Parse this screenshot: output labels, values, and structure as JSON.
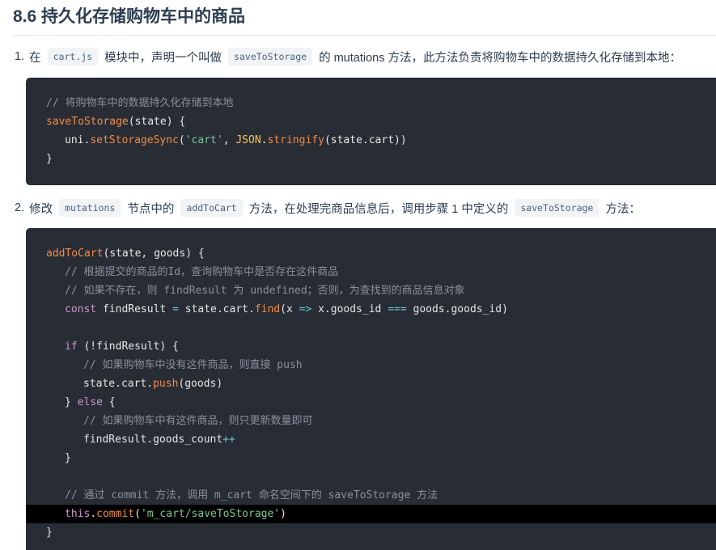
{
  "section": {
    "title": "8.6 持久化存储购物车中的商品"
  },
  "step1": {
    "num": "1.",
    "pre": "在",
    "code1": "cart.js",
    "mid": "模块中，声明一个叫做",
    "code2": "saveToStorage",
    "post": "的 mutations 方法，此方法负责将购物车中的数据持久化存储到本地："
  },
  "block1": {
    "comment": "// 将购物车中的数据持久化存储到本地",
    "fn_name": "saveToStorage",
    "fn_args": "(state) {",
    "call_obj": "uni.",
    "call_fn": "setStorageSync",
    "call_open": "(",
    "call_str": "'cart'",
    "call_comma": ", ",
    "json": "JSON",
    "dot": ".",
    "stringify": "stringify",
    "call_rest": "(state.cart))",
    "close": "}"
  },
  "step2": {
    "num": "2.",
    "pre": "修改",
    "code1": "mutations",
    "mid1": "节点中的",
    "code2": "addToCart",
    "mid2": "方法，在处理完商品信息后，调用步骤 1 中定义的",
    "code3": "saveToStorage",
    "post": "方法："
  },
  "block2": {
    "l1_fn": "addToCart",
    "l1_rest": "(state, goods) {",
    "l2": "// 根据提交的商品的Id，查询购物车中是否存在这件商品",
    "l3": "// 如果不存在，则 findResult 为 undefined；否则，为查找到的商品信息对象",
    "l4_kw": "const",
    "l4_a": " findResult ",
    "l4_eq": "=",
    "l4_b": " state.cart.",
    "l4_find": "find",
    "l4_c": "(x ",
    "l4_arrow": "=>",
    "l4_d": " x.goods_id ",
    "l4_eqq": "===",
    "l4_e": " goods.goods_id)",
    "l6_kw": "if",
    "l6_rest": " (!findResult) {",
    "l7": "// 如果购物车中没有这件商品，则直接 push",
    "l8_a": "state.cart.",
    "l8_push": "push",
    "l8_b": "(goods)",
    "l9_a": "} ",
    "l9_kw": "else",
    "l9_b": " {",
    "l10": "// 如果购物车中有这件商品，则只更新数量即可",
    "l11_a": "findResult.goods_count",
    "l11_op": "++",
    "l12": "}",
    "l14": "// 通过 commit 方法，调用 m_cart 命名空间下的 saveToStorage 方法",
    "l15_kw": "this",
    "l15_dot": ".",
    "l15_fn": "commit",
    "l15_open": "(",
    "l15_str": "'m_cart/saveToStorage'",
    "l15_close": ")",
    "l16": "}"
  }
}
